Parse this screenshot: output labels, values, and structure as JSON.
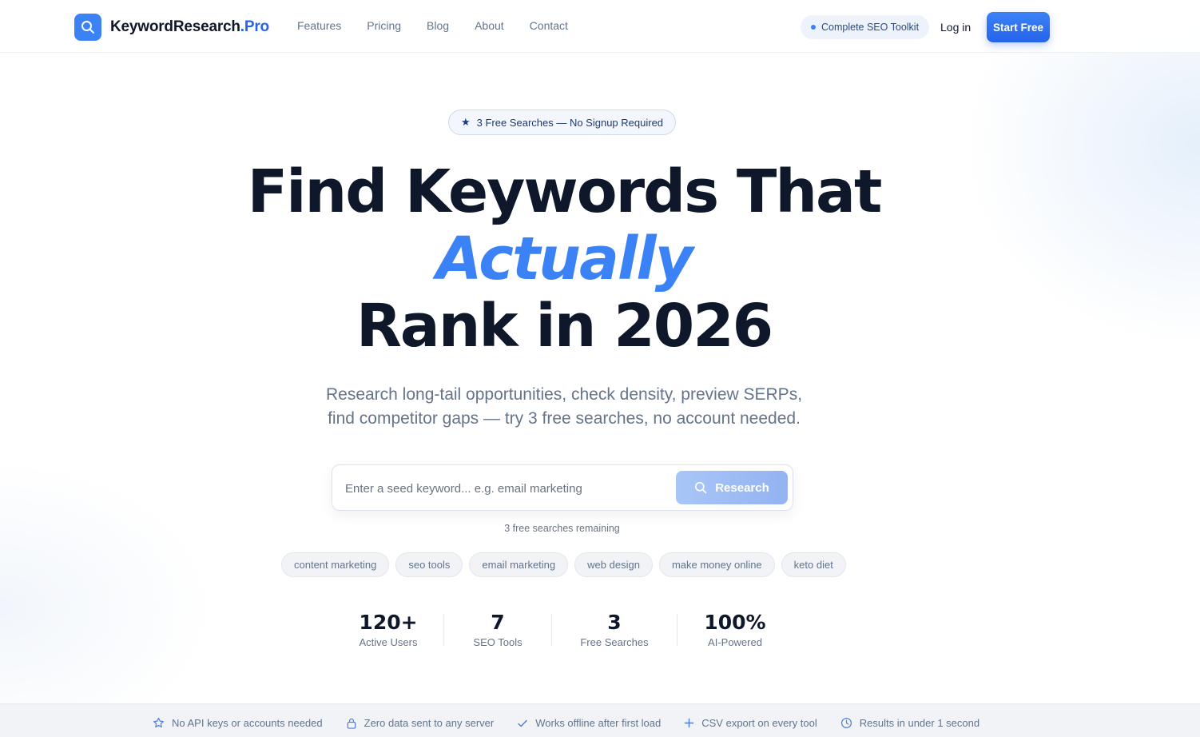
{
  "brand": {
    "name_main": "KeywordResearch",
    "name_suffix": ".Pro"
  },
  "nav": {
    "links": [
      "Features",
      "Pricing",
      "Blog",
      "About",
      "Contact"
    ],
    "toolkit_badge": "Complete SEO Toolkit",
    "login": "Log in",
    "start_free": "Start Free"
  },
  "hero": {
    "badge": "3 Free Searches — No Signup Required",
    "headline_line1": "Find Keywords That",
    "headline_accent": "Actually",
    "headline_line3": "Rank in 2026",
    "subhead_line1": "Research long-tail opportunities, check density, preview SERPs,",
    "subhead_line2": "find competitor gaps — try 3 free searches, no account needed."
  },
  "search": {
    "placeholder": "Enter a seed keyword... e.g. email marketing",
    "value": "",
    "button": "Research",
    "remaining": "3 free searches remaining"
  },
  "suggestions": [
    "content marketing",
    "seo tools",
    "email marketing",
    "web design",
    "make money online",
    "keto diet"
  ],
  "stats": [
    {
      "value": "120+",
      "label": "Active Users"
    },
    {
      "value": "7",
      "label": "SEO Tools"
    },
    {
      "value": "3",
      "label": "Free Searches"
    },
    {
      "value": "100%",
      "label": "AI-Powered"
    }
  ],
  "trust": [
    {
      "icon": "star-icon",
      "text": "No API keys or accounts needed"
    },
    {
      "icon": "lock-icon",
      "text": "Zero data sent to any server"
    },
    {
      "icon": "check-icon",
      "text": "Works offline after first load"
    },
    {
      "icon": "plus-icon",
      "text": "CSV export on every tool"
    },
    {
      "icon": "clock-icon",
      "text": "Results in under 1 second"
    }
  ],
  "colors": {
    "accent": "#3b82f6",
    "accent_dark": "#2563eb",
    "text": "#0f172a",
    "muted": "#64748b"
  }
}
